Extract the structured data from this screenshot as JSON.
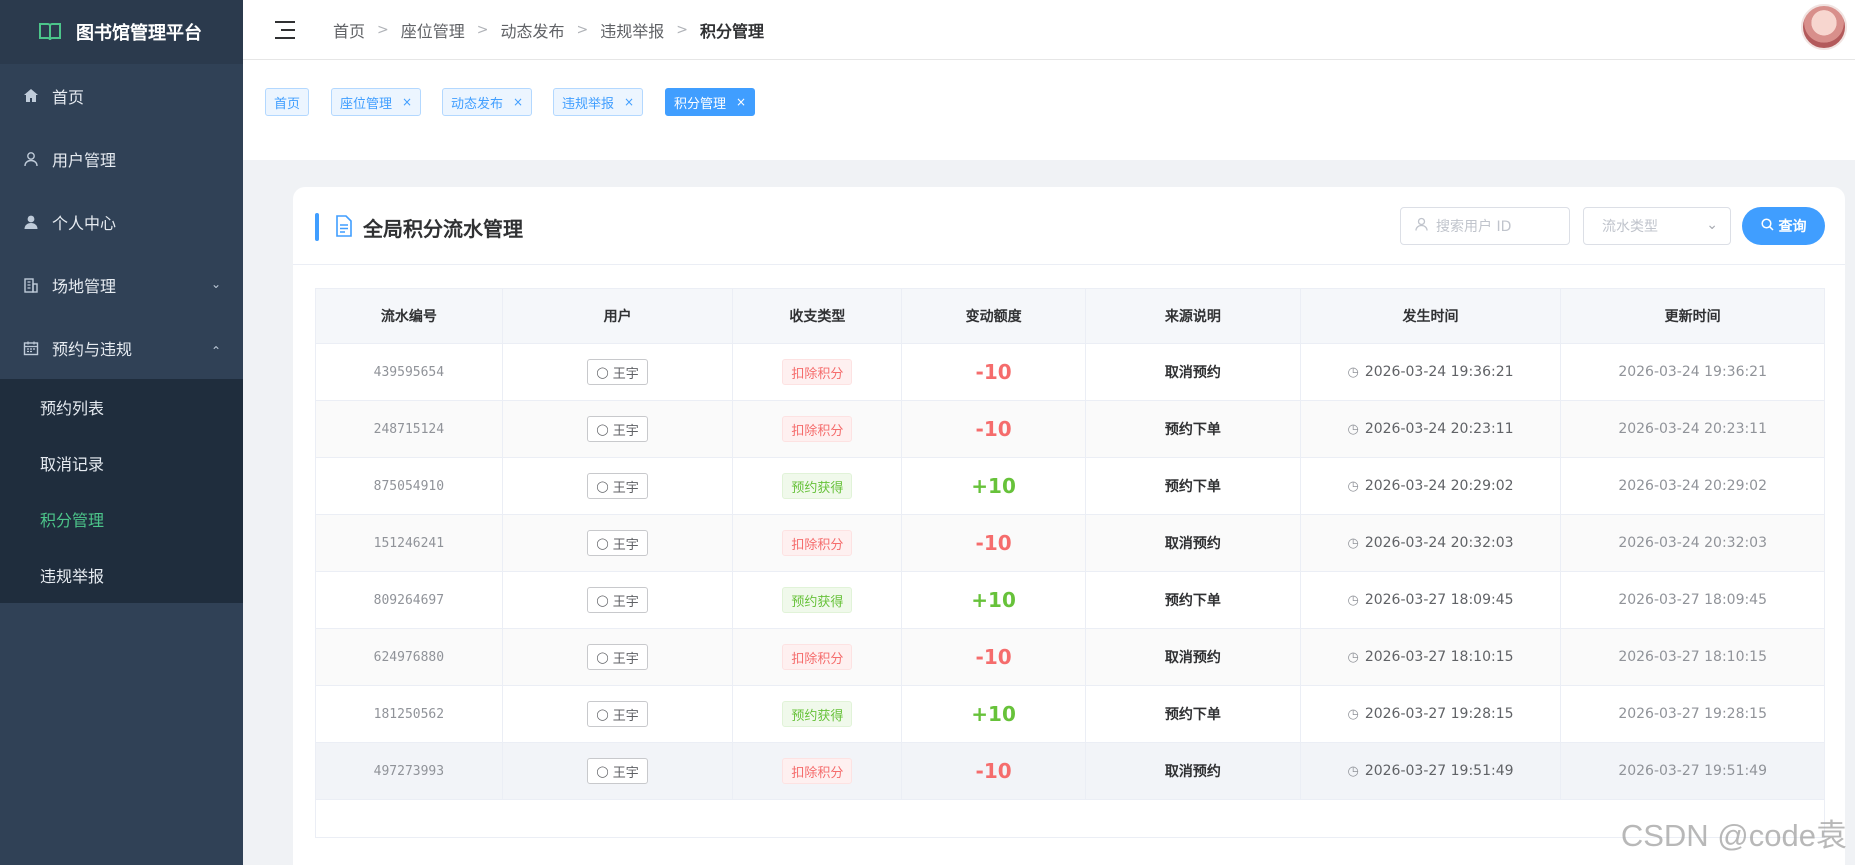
{
  "app": {
    "title": "图书馆管理平台"
  },
  "sidebar": {
    "items": [
      {
        "label": "首页",
        "icon": "home-icon"
      },
      {
        "label": "用户管理",
        "icon": "user-icon"
      },
      {
        "label": "个人中心",
        "icon": "person-icon"
      },
      {
        "label": "场地管理",
        "icon": "building-icon"
      },
      {
        "label": "预约与违规",
        "icon": "calendar-icon"
      }
    ],
    "submenu": [
      "预约列表",
      "取消记录",
      "积分管理",
      "违规举报"
    ]
  },
  "breadcrumb": [
    "首页",
    "座位管理",
    "动态发布",
    "违规举报",
    "积分管理"
  ],
  "tabs": [
    {
      "label": "首页"
    },
    {
      "label": "座位管理"
    },
    {
      "label": "动态发布"
    },
    {
      "label": "违规举报"
    },
    {
      "label": "积分管理"
    }
  ],
  "card": {
    "title": "全局积分流水管理",
    "search_placeholder": "搜索用户 ID",
    "select_placeholder": "流水类型",
    "query_label": "查询"
  },
  "table": {
    "headers": [
      "流水编号",
      "用户",
      "收支类型",
      "变动额度",
      "来源说明",
      "发生时间",
      "更新时间"
    ],
    "rows": [
      {
        "id": "439595654",
        "user": "王宇",
        "type": "扣除积分",
        "amount": "-10",
        "source": "取消预约",
        "created": "2026-03-24 19:36:21",
        "updated": "2026-03-24 19:36:21"
      },
      {
        "id": "248715124",
        "user": "王宇",
        "type": "扣除积分",
        "amount": "-10",
        "source": "预约下单",
        "created": "2026-03-24 20:23:11",
        "updated": "2026-03-24 20:23:11"
      },
      {
        "id": "875054910",
        "user": "王宇",
        "type": "预约获得",
        "amount": "+10",
        "source": "预约下单",
        "created": "2026-03-24 20:29:02",
        "updated": "2026-03-24 20:29:02"
      },
      {
        "id": "151246241",
        "user": "王宇",
        "type": "扣除积分",
        "amount": "-10",
        "source": "取消预约",
        "created": "2026-03-24 20:32:03",
        "updated": "2026-03-24 20:32:03"
      },
      {
        "id": "809264697",
        "user": "王宇",
        "type": "预约获得",
        "amount": "+10",
        "source": "预约下单",
        "created": "2026-03-27 18:09:45",
        "updated": "2026-03-27 18:09:45"
      },
      {
        "id": "624976880",
        "user": "王宇",
        "type": "扣除积分",
        "amount": "-10",
        "source": "取消预约",
        "created": "2026-03-27 18:10:15",
        "updated": "2026-03-27 18:10:15"
      },
      {
        "id": "181250562",
        "user": "王宇",
        "type": "预约获得",
        "amount": "+10",
        "source": "预约下单",
        "created": "2026-03-27 19:28:15",
        "updated": "2026-03-27 19:28:15"
      },
      {
        "id": "497273993",
        "user": "王宇",
        "type": "扣除积分",
        "amount": "-10",
        "source": "取消预约",
        "created": "2026-03-27 19:51:49",
        "updated": "2026-03-27 19:51:49"
      }
    ]
  },
  "watermark": "CSDN @code袁",
  "colors": {
    "accent": "#409eff",
    "sidebar": "#304156",
    "active_menu": "#4cc58a",
    "negative": "#f56c6c",
    "positive": "#67c23a"
  }
}
